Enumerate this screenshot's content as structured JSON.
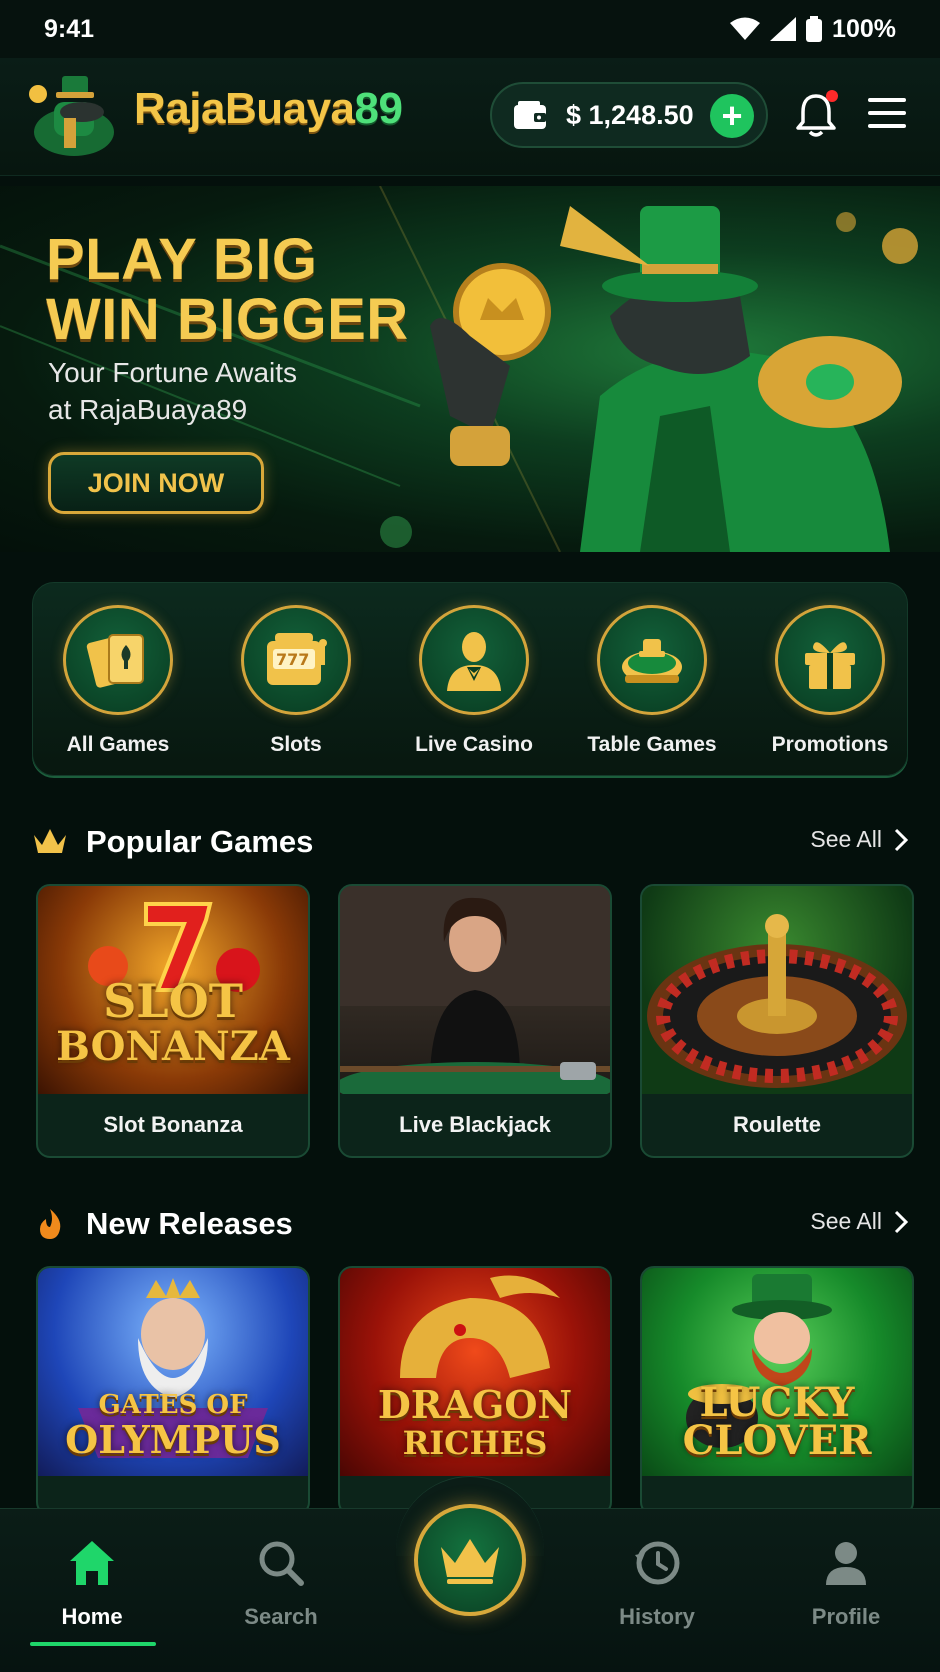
{
  "status_bar": {
    "time": "9:41",
    "battery": "100%"
  },
  "header": {
    "brand_part1": "RajaBuaya",
    "brand_part2": "89",
    "balance": "$ 1,248.50",
    "add_funds": "+"
  },
  "hero": {
    "title_line1": "PLAY BIG",
    "title_line2": "WIN BIGGER",
    "subtitle_line1": "Your Fortune Awaits",
    "subtitle_line2": "at RajaBuaya89",
    "cta": "JOIN NOW"
  },
  "categories": [
    {
      "label": "All Games",
      "icon": "cards-icon"
    },
    {
      "label": "Slots",
      "icon": "slot-machine-icon"
    },
    {
      "label": "Live Casino",
      "icon": "dealer-icon"
    },
    {
      "label": "Table Games",
      "icon": "roulette-table-icon"
    },
    {
      "label": "Promotions",
      "icon": "gift-icon"
    }
  ],
  "popular": {
    "title": "Popular Games",
    "see_all": "See All",
    "games": [
      {
        "label": "Slot Bonanza",
        "art_line1": "SLOT",
        "art_line2": "BONANZA"
      },
      {
        "label": "Live Blackjack"
      },
      {
        "label": "Roulette"
      }
    ]
  },
  "new_releases": {
    "title": "New Releases",
    "see_all": "See All",
    "games": [
      {
        "art_line1": "GATES OF",
        "art_line2": "OLYMPUS"
      },
      {
        "art_line1": "DRAGON",
        "art_line2": "RICHES"
      },
      {
        "art_line1": "LUCKY",
        "art_line2": "CLOVER"
      }
    ]
  },
  "bottom_nav": {
    "items": [
      {
        "label": "Home",
        "active": true
      },
      {
        "label": "Search"
      },
      {
        "label": "History"
      },
      {
        "label": "Profile"
      }
    ]
  },
  "colors": {
    "gold": "#f3c548",
    "green_accent": "#1fd66a",
    "background": "#04100c"
  }
}
